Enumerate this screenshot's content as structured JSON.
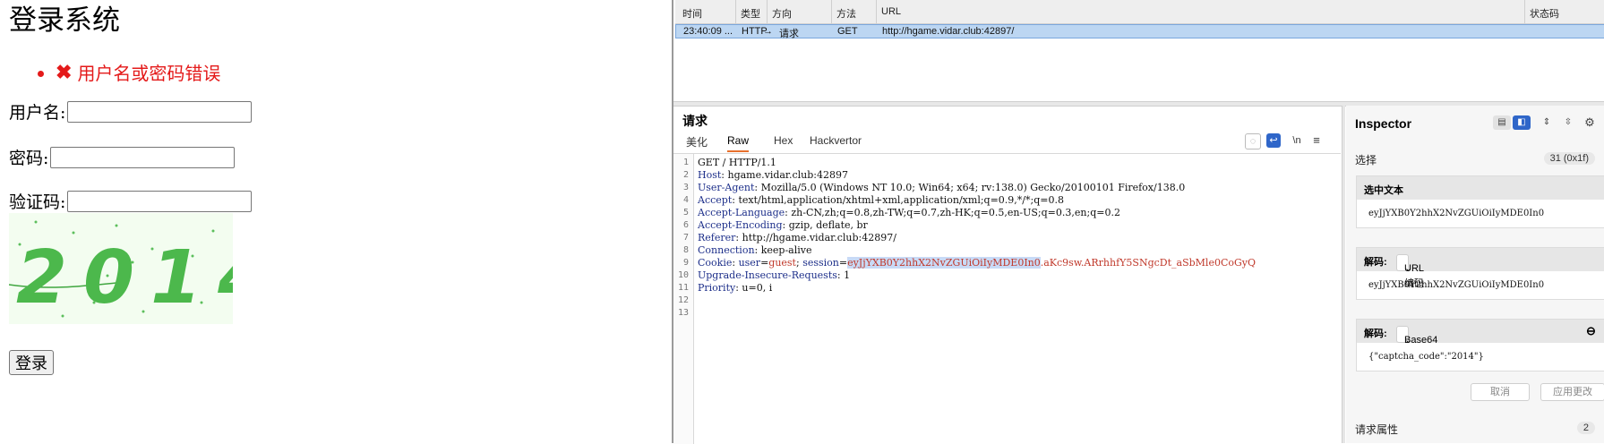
{
  "login": {
    "title": "登录系统",
    "error_message": "用户名或密码错误",
    "username_label": "用户名:",
    "password_label": "密码:",
    "captcha_label": "验证码:",
    "captcha_text": "2014",
    "submit_label": "登录"
  },
  "history": {
    "columns": [
      "时间",
      "类型",
      "方向",
      "方法",
      "URL",
      "状态码"
    ],
    "row": {
      "time": "23:40:09 ...",
      "type": "HTTP",
      "direction": "请求",
      "method": "GET",
      "url": "http://hgame.vidar.club:42897/"
    }
  },
  "request": {
    "title": "请求",
    "tabs": [
      "美化",
      "Raw",
      "Hex",
      "Hackvertor"
    ],
    "active_tab": "Raw",
    "toolbar": {
      "newline_label": "\\n"
    },
    "lines": [
      {
        "n": "1",
        "key": "",
        "value": "GET / HTTP/1.1"
      },
      {
        "n": "2",
        "key": "Host",
        "value": ": hgame.vidar.club:42897"
      },
      {
        "n": "3",
        "key": "User-Agent",
        "value": ": Mozilla/5.0 (Windows NT 10.0; Win64; x64; rv:138.0) Gecko/20100101 Firefox/138.0"
      },
      {
        "n": "4",
        "key": "Accept",
        "value": ": text/html,application/xhtml+xml,application/xml;q=0.9,*/*;q=0.8"
      },
      {
        "n": "5",
        "key": "Accept-Language",
        "value": ": zh-CN,zh;q=0.8,zh-TW;q=0.7,zh-HK;q=0.5,en-US;q=0.3,en;q=0.2"
      },
      {
        "n": "6",
        "key": "Accept-Encoding",
        "value": ": gzip, deflate, br"
      },
      {
        "n": "7",
        "key": "Referer",
        "value": ": http://hgame.vidar.club:42897/"
      },
      {
        "n": "8",
        "key": "Connection",
        "value": ": keep-alive"
      },
      {
        "n": "10",
        "key": "Upgrade-Insecure-Requests",
        "value": ": 1"
      },
      {
        "n": "11",
        "key": "Priority",
        "value": ": u=0, i"
      }
    ],
    "cookie_line": {
      "n": "9",
      "key": "Cookie",
      "sep": ": ",
      "c1_key": "user",
      "c1_eq": "=",
      "c1_val": "guest",
      "semi": "; ",
      "c2_key": "session",
      "c2_eq": "=",
      "c2_selected": "eyJjYXB0Y2hhX2NvZGUiOiIyMDE0In0",
      "c2_rest": ".aKc9sw.ARrhhfY5SNgcDt_aSbMle0CoGyQ"
    },
    "empty_lines": [
      "12",
      "13"
    ]
  },
  "inspector": {
    "title": "Inspector",
    "selection_label": "选择",
    "selection_count": "31 (0x1f)",
    "selected_text_label": "选中文本",
    "selected_text": "eyJjYXB0Y2hhX2NvZGUiOiIyMDE0In0",
    "decode1_label": "解码:",
    "decode1_type": "URL编码",
    "decode1_value": "eyJjYXB0Y2hhX2NvZGUiOiIyMDE0In0",
    "decode2_label": "解码:",
    "decode2_type": "Base64",
    "decode2_value": "{\"captcha_code\":\"2014\"}",
    "cancel_label": "取消",
    "apply_label": "应用更改",
    "request_attrs_label": "请求属性",
    "request_attrs_count": "2"
  }
}
